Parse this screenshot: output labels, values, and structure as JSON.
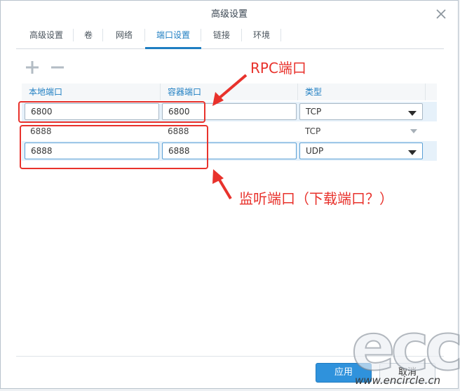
{
  "dialog": {
    "title": "高级设置",
    "tabs": [
      {
        "label": "高级设置"
      },
      {
        "label": "卷"
      },
      {
        "label": "网络"
      },
      {
        "label": "端口设置"
      },
      {
        "label": "链接"
      },
      {
        "label": "环境"
      }
    ],
    "active_tab": "端口设置"
  },
  "toolbar": {
    "add_icon": "plus-icon",
    "remove_icon": "minus-icon"
  },
  "table": {
    "columns": [
      "本地端口",
      "容器端口",
      "类型"
    ],
    "rows": [
      {
        "local_port": "6800",
        "container_port": "6800",
        "type": "TCP"
      },
      {
        "local_port": "6888",
        "container_port": "6888",
        "type": "TCP"
      },
      {
        "local_port": "6888",
        "container_port": "6888",
        "type": "UDP"
      }
    ]
  },
  "annotations": {
    "rpc_label": "RPC端口",
    "listen_label": "监听端口（下载端口？）",
    "color": "#e8322c"
  },
  "footer": {
    "apply_label": "应用",
    "cancel_label": "取消"
  },
  "watermark": {
    "letters": "ecc",
    "url": "www.encircle.cn"
  },
  "colors": {
    "accent": "#1e7ec2",
    "primary_button": "#2f92dc"
  }
}
